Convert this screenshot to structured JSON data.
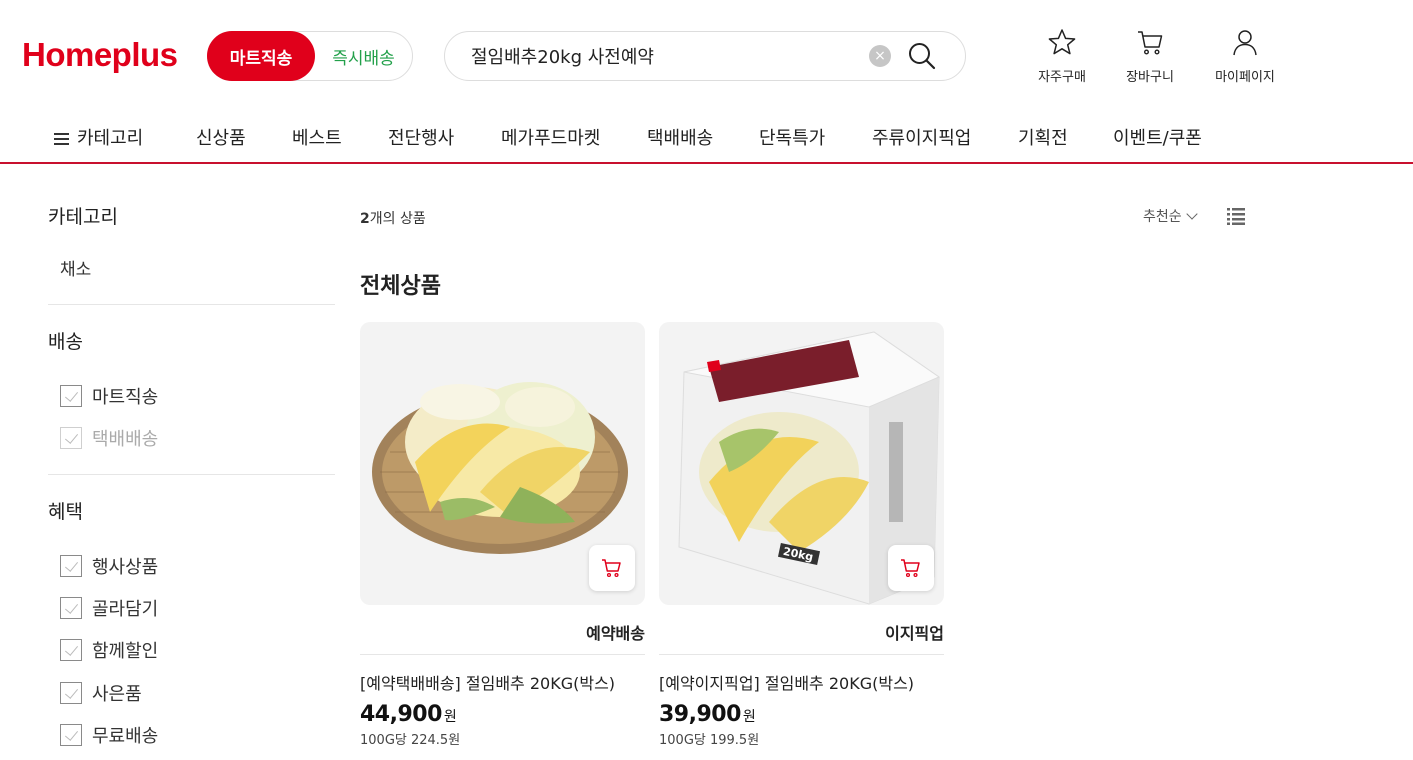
{
  "header": {
    "logo": "Homeplus",
    "mode_active": "마트직송",
    "mode_other": "즉시배송",
    "search_value": "절임배추20kg 사전예약",
    "clear_symbol": "×",
    "utils": [
      {
        "label": "자주구매",
        "icon": "star-icon"
      },
      {
        "label": "장바구니",
        "icon": "cart-icon"
      },
      {
        "label": "마이페이지",
        "icon": "user-icon"
      }
    ]
  },
  "nav": {
    "items": [
      "카테고리",
      "신상품",
      "베스트",
      "전단행사",
      "메가푸드마켓",
      "택배배송",
      "단독특가",
      "주류이지픽업",
      "기획전",
      "이벤트/쿠폰"
    ]
  },
  "sidebar": {
    "category_title": "카테고리",
    "category_item": "채소",
    "delivery_title": "배송",
    "delivery_options": [
      "마트직송",
      "택배배송"
    ],
    "benefit_title": "혜택",
    "benefit_options": [
      "행사상품",
      "골라담기",
      "함께할인",
      "사은품",
      "무료배송"
    ]
  },
  "main": {
    "count_num": "2",
    "count_suffix": "개의 상품",
    "sort_label": "추천순",
    "section_title": "전체상품",
    "products": [
      {
        "tag": "예약배송",
        "name": "[예약택배배송] 절임배추 20KG(박스)",
        "price": "44,900",
        "currency": "원",
        "unit_price": "100G당 224.5원"
      },
      {
        "tag": "이지픽업",
        "name": "[예약이지픽업] 절임배추 20KG(박스)",
        "price": "39,900",
        "currency": "원",
        "unit_price": "100G당 199.5원",
        "box_label": "20kg"
      }
    ]
  },
  "colors": {
    "brand": "#e0001b",
    "accent_green": "#22a04a",
    "nav_border": "#c8102e"
  }
}
